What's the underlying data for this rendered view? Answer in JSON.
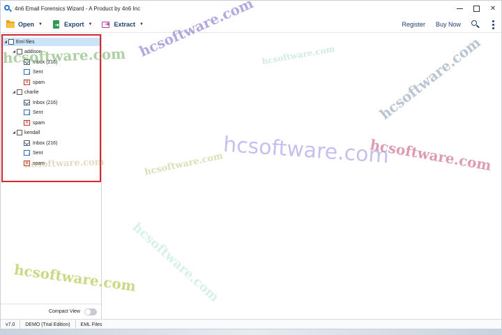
{
  "window": {
    "title": "4n6 Email Forensics Wizard - A Product by 4n6 Inc",
    "controls": {
      "close": "✕",
      "restore": "",
      "minimize": ""
    }
  },
  "toolbar": {
    "open_label": "Open",
    "export_label": "Export",
    "extract_label": "Extract",
    "register_label": "Register",
    "buy_label": "Buy Now"
  },
  "tree": {
    "root": {
      "label": "Eml files"
    },
    "accounts": [
      {
        "name": "addison",
        "folders": [
          "Inbox (216)",
          "Sent",
          "spam"
        ]
      },
      {
        "name": "charlie",
        "folders": [
          "Inbox (216)",
          "Sent",
          "spam"
        ]
      },
      {
        "name": "kendall",
        "folders": [
          "Inbox (216)",
          "Sent",
          "spam"
        ]
      }
    ]
  },
  "compact_view": {
    "label": "Compact View",
    "enabled": false
  },
  "statusbar": {
    "version": "v7.0",
    "edition": "DEMO (Trial Edition)",
    "mode": "EML Files"
  },
  "colors": {
    "tree_highlight": "#d9262e",
    "selected_row": "#cce4f7",
    "toolbar_text": "#1d3f72"
  },
  "watermarks": [
    "hcsoftware.com",
    "hcsoftware.com",
    "hcsoftware.com",
    "hcsoftware.com",
    "hcsoftware.com",
    "hcsoftware.com",
    "hcsoftware.com",
    "hcsoftware.com",
    "hcsoftware.com",
    "hcsoftware.com"
  ]
}
